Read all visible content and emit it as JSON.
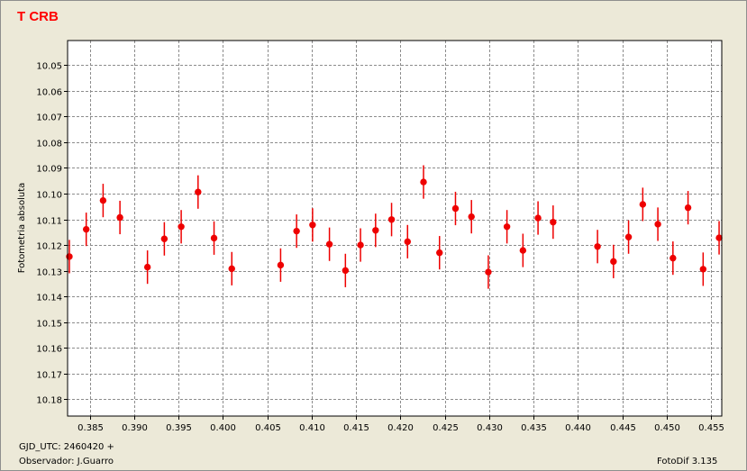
{
  "chart_data": {
    "type": "scatter",
    "title": "T CRB",
    "xlabel": "",
    "ylabel": "Fotometria absoluta",
    "x_tick_labels": [
      "0.385",
      "0.390",
      "0.395",
      "0.400",
      "0.405",
      "0.410",
      "0.415",
      "0.420",
      "0.425",
      "0.430",
      "0.435",
      "0.440",
      "0.445",
      "0.450",
      "0.455"
    ],
    "y_tick_labels": [
      "10.05",
      "10.06",
      "10.07",
      "10.08",
      "10.09",
      "10.10",
      "10.11",
      "10.12",
      "10.13",
      "10.14",
      "10.15",
      "10.16",
      "10.17",
      "10.18"
    ],
    "xlim": [
      0.3825,
      0.4562
    ],
    "ylim": [
      10.0405,
      10.1865
    ],
    "y_inverted": true,
    "grid": true,
    "marker_color": "#ee0000",
    "error_bar": 0.0065,
    "points": [
      {
        "x": 0.3827,
        "y": 10.1245
      },
      {
        "x": 0.3846,
        "y": 10.1139
      },
      {
        "x": 0.3865,
        "y": 10.1027
      },
      {
        "x": 0.3884,
        "y": 10.1093
      },
      {
        "x": 0.3915,
        "y": 10.1286
      },
      {
        "x": 0.3934,
        "y": 10.1176
      },
      {
        "x": 0.3953,
        "y": 10.1129
      },
      {
        "x": 0.3972,
        "y": 10.0994
      },
      {
        "x": 0.399,
        "y": 10.1173
      },
      {
        "x": 0.401,
        "y": 10.1292
      },
      {
        "x": 0.4065,
        "y": 10.1278
      },
      {
        "x": 0.4083,
        "y": 10.1146
      },
      {
        "x": 0.4101,
        "y": 10.1122
      },
      {
        "x": 0.412,
        "y": 10.1197
      },
      {
        "x": 0.4138,
        "y": 10.1299
      },
      {
        "x": 0.4155,
        "y": 10.12
      },
      {
        "x": 0.4172,
        "y": 10.1143
      },
      {
        "x": 0.419,
        "y": 10.1101
      },
      {
        "x": 0.4208,
        "y": 10.1187
      },
      {
        "x": 0.4226,
        "y": 10.0955
      },
      {
        "x": 0.4244,
        "y": 10.123
      },
      {
        "x": 0.4262,
        "y": 10.1058
      },
      {
        "x": 0.428,
        "y": 10.109
      },
      {
        "x": 0.4299,
        "y": 10.1305
      },
      {
        "x": 0.432,
        "y": 10.1129
      },
      {
        "x": 0.4338,
        "y": 10.1221
      },
      {
        "x": 0.4355,
        "y": 10.1095
      },
      {
        "x": 0.4372,
        "y": 10.1111
      },
      {
        "x": 0.4422,
        "y": 10.1206
      },
      {
        "x": 0.444,
        "y": 10.1264
      },
      {
        "x": 0.4457,
        "y": 10.1169
      },
      {
        "x": 0.4473,
        "y": 10.1042
      },
      {
        "x": 0.449,
        "y": 10.1119
      },
      {
        "x": 0.4507,
        "y": 10.1251
      },
      {
        "x": 0.4524,
        "y": 10.1055
      },
      {
        "x": 0.4541,
        "y": 10.1294
      },
      {
        "x": 0.4559,
        "y": 10.1172
      }
    ]
  },
  "footer": {
    "gjd": "GJD_UTC: 2460420 +",
    "observer": "Observador: J.Guarro",
    "version": "FotoDif 3.135"
  }
}
